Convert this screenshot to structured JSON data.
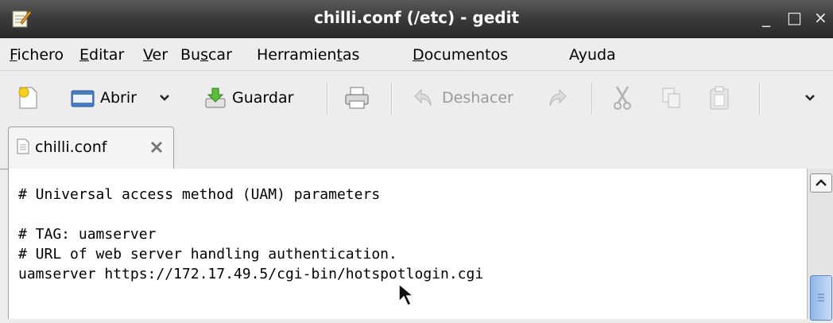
{
  "window": {
    "title": "chilli.conf (/etc) - gedit",
    "controls": {
      "minimize": "_",
      "maximize": "□",
      "close": "×"
    }
  },
  "menubar": {
    "items": [
      {
        "accel": "F",
        "rest": "ichero"
      },
      {
        "accel": "E",
        "rest": "ditar"
      },
      {
        "accel": "V",
        "rest": "er"
      },
      {
        "pre": "Bu",
        "accel": "s",
        "rest": "car"
      },
      {
        "pre": "Herramien",
        "accel": "t",
        "rest": "as"
      },
      {
        "accel": "D",
        "rest": "ocumentos"
      },
      {
        "pre": "Ayuda",
        "accel": "",
        "rest": ""
      }
    ]
  },
  "toolbar": {
    "open_label": "Abrir",
    "save_label": "Guardar",
    "undo_label": "Deshacer"
  },
  "tab": {
    "label": "chilli.conf"
  },
  "editor": {
    "lines": [
      "# Universal access method (UAM) parameters",
      "",
      "# TAG: uamserver",
      "# URL of web server handling authentication.",
      "uamserver https://172.17.49.5/cgi-bin/hotspotlogin.cgi"
    ]
  },
  "icons": [
    "gedit-app-icon",
    "new-document-icon",
    "open-folder-icon",
    "chevron-down-icon",
    "save-icon",
    "print-icon",
    "undo-icon",
    "redo-icon",
    "cut-icon",
    "copy-icon",
    "paste-icon",
    "document-icon",
    "tab-close-icon",
    "scroll-up-icon",
    "mouse-cursor-icon"
  ]
}
